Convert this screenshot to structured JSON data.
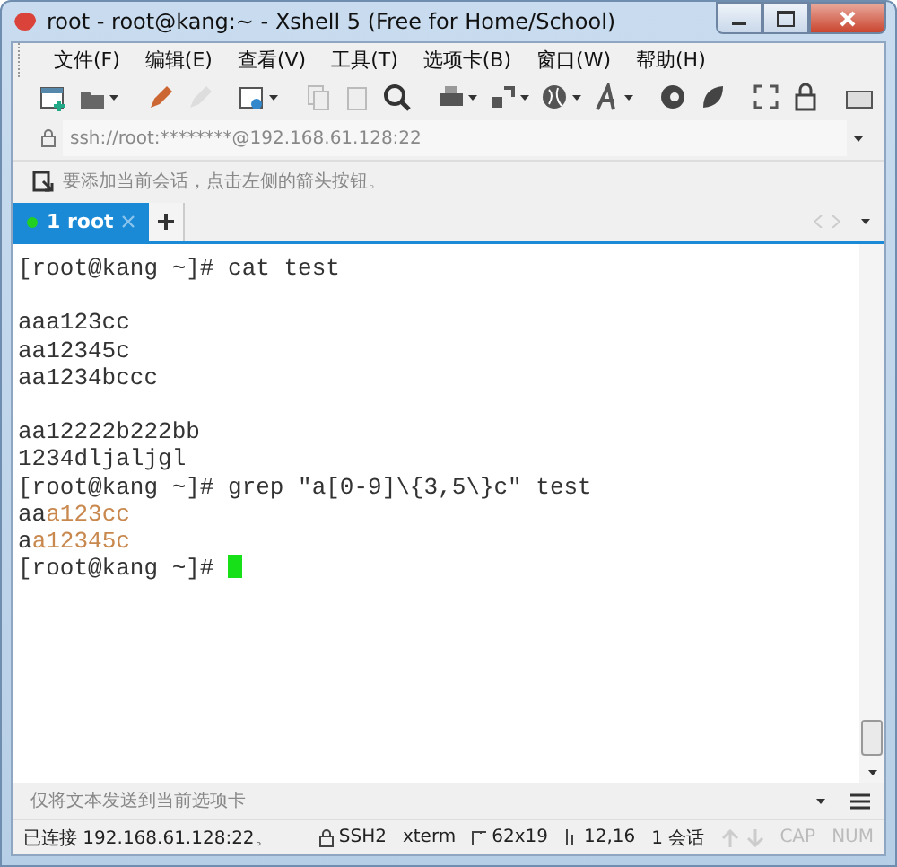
{
  "window": {
    "title": "root - root@kang:~ - Xshell 5 (Free for Home/School)"
  },
  "menu": [
    "文件(F)",
    "编辑(E)",
    "查看(V)",
    "工具(T)",
    "选项卡(B)",
    "窗口(W)",
    "帮助(H)"
  ],
  "address": {
    "value": "ssh://root:********@192.168.61.128:22"
  },
  "hint": "要添加当前会话，点击左侧的箭头按钮。",
  "tabs": [
    {
      "label": "1 root",
      "selected": true,
      "connected": true
    }
  ],
  "terminal": {
    "lines": [
      {
        "kind": "text",
        "segments": [
          {
            "text": "[root@kang ~]# cat test",
            "highlight": false
          }
        ]
      },
      {
        "kind": "blank"
      },
      {
        "kind": "text",
        "segments": [
          {
            "text": "aaa123cc",
            "highlight": false
          }
        ]
      },
      {
        "kind": "text",
        "segments": [
          {
            "text": "aa12345c",
            "highlight": false
          }
        ]
      },
      {
        "kind": "text",
        "segments": [
          {
            "text": "aa1234bccc",
            "highlight": false
          }
        ]
      },
      {
        "kind": "blank"
      },
      {
        "kind": "text",
        "segments": [
          {
            "text": "aa12222b222bb",
            "highlight": false
          }
        ]
      },
      {
        "kind": "text",
        "segments": [
          {
            "text": "1234dljaljgl",
            "highlight": false
          }
        ]
      },
      {
        "kind": "text",
        "segments": [
          {
            "text": "[root@kang ~]# grep \"a[0-9]\\{3,5\\}c\" test",
            "highlight": false
          }
        ]
      },
      {
        "kind": "text",
        "segments": [
          {
            "text": "aa",
            "highlight": false
          },
          {
            "text": "a123cc",
            "highlight": true
          }
        ]
      },
      {
        "kind": "text",
        "segments": [
          {
            "text": "a",
            "highlight": false
          },
          {
            "text": "a12345c",
            "highlight": true
          }
        ]
      },
      {
        "kind": "text",
        "segments": [
          {
            "text": "[root@kang ~]# ",
            "highlight": false
          }
        ]
      }
    ],
    "cursor": true
  },
  "send_bar": {
    "placeholder": "仅将文本发送到当前选项卡"
  },
  "status_bar": [
    {
      "kind": "text",
      "text": "已连接 192.168.61.128:22。",
      "disabled": false
    },
    {
      "kind": "lock",
      "text": "SSH2",
      "disabled": false
    },
    {
      "kind": "text",
      "text": "xterm",
      "disabled": false
    },
    {
      "kind": "size",
      "text": "62x19",
      "disabled": false
    },
    {
      "kind": "pos",
      "text": "12,16",
      "disabled": false
    },
    {
      "kind": "text",
      "text": "1 会话",
      "disabled": false
    },
    {
      "kind": "arrows",
      "disabled": true
    },
    {
      "kind": "text",
      "text": "CAP",
      "disabled": true
    },
    {
      "kind": "text",
      "text": "NUM",
      "disabled": true
    }
  ]
}
